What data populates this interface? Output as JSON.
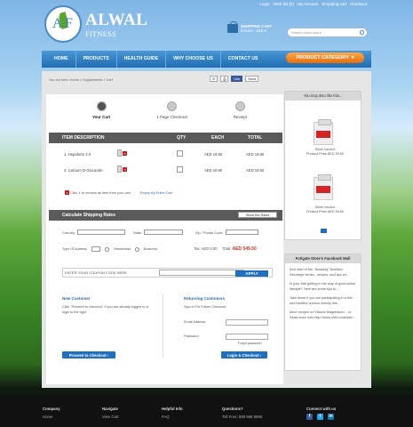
{
  "topnav": [
    "Login",
    "Wish list (0)",
    "My Account",
    "Shopping cart",
    "Checkout"
  ],
  "brand": {
    "initial1": "A",
    "initial2": "F",
    "name": "ALWAL",
    "sub": "FITNESS"
  },
  "cart": {
    "title": "SHOPPING CART",
    "summary": "0 items - AED 0"
  },
  "search": {
    "placeholder": "Search entire store"
  },
  "nav": [
    "HOME",
    "PRODUCTS",
    "HEALTH GUIDE",
    "WHY CHOOSE US",
    "CONTACT US"
  ],
  "product_category": "PRODUCT CATEGORY",
  "breadcrumb": "You are here: Home > Supplements > Cart",
  "social": {
    "like": "Like",
    "send": "Send"
  },
  "steps": [
    "Your Cart",
    "1 Page Checkout",
    "Receipt"
  ],
  "table": {
    "headers": [
      "ITEM DESCRIPTION",
      "QTY",
      "EACH",
      "TOTAL"
    ],
    "rows": [
      {
        "name": "1. Hepaforte 2.0",
        "qty": "1",
        "each": "AED 19.50",
        "total": "AED 19.50"
      },
      {
        "name": "2. Calcium D-Glucarate",
        "qty": "1",
        "each": "AED 19.50",
        "total": "AED 19.50"
      }
    ]
  },
  "note": {
    "text": "Click X to remove an item from your cart",
    "empty": "Empty My Entire Cart"
  },
  "shipping": {
    "title": "Calculate Shipping Rates",
    "button": "Show the Rates",
    "country": "Country",
    "state": "State",
    "zip": "Zip / Postal Code",
    "type_label": "Type Of Address",
    "residential": "Residential",
    "business": "Business",
    "tax_label": "Tax: AED 0.00",
    "total_label": "Total:",
    "total_value": "AED 549.50"
  },
  "coupon": {
    "label": "ENTER YOUR COUPON CODE HERE",
    "apply": "APPLY"
  },
  "new_customer": {
    "title": "New Customer",
    "text": "Click \"Proceed to checkout\" if you are already logged in or login to the right",
    "button": "Proceed to Checkout"
  },
  "returning": {
    "title": "Returning Customers",
    "text": "Sign in For Faster Checkout",
    "email": "Email Address",
    "password": "Password",
    "forgot": "Forgot password?",
    "button": "Login & Checkout"
  },
  "sidebar": {
    "title": "You may also like this...",
    "products": [
      {
        "name": "Silver Ionolox",
        "price": "Product Price AED 35.50"
      },
      {
        "name": "Silver Ionolox",
        "price": "Product Price AED 35.50"
      }
    ]
  },
  "facebook": {
    "title": "Fotigate Store's Facebook Wall",
    "posts": [
      "Kick start of the \"Amazing\" Nutrition Recharge series - recipes, and tips on...",
      "Is your Salt getting in the way of good active lifestyle? Here are some tips to...",
      "Take these if you are participating in a five and twelfths outdoor activity this...",
      "More recipes on Vitamin Magnesium... or Read more over http://www.chef.co/article/..."
    ]
  },
  "footer": [
    {
      "title": "Company",
      "item": "Home"
    },
    {
      "title": "Navigate",
      "item": "View Cart"
    },
    {
      "title": "Helpful Info",
      "item": "FAQ"
    },
    {
      "title": "Questions?",
      "item": "Toll Free: 888 888 8888"
    },
    {
      "title": "Connect with us",
      "item": ""
    }
  ],
  "colors": {
    "nav_blue": "#1f6db0",
    "orange": "#e66d09",
    "total_red": "#d12a1e",
    "button_blue": "#1e6fc0"
  }
}
